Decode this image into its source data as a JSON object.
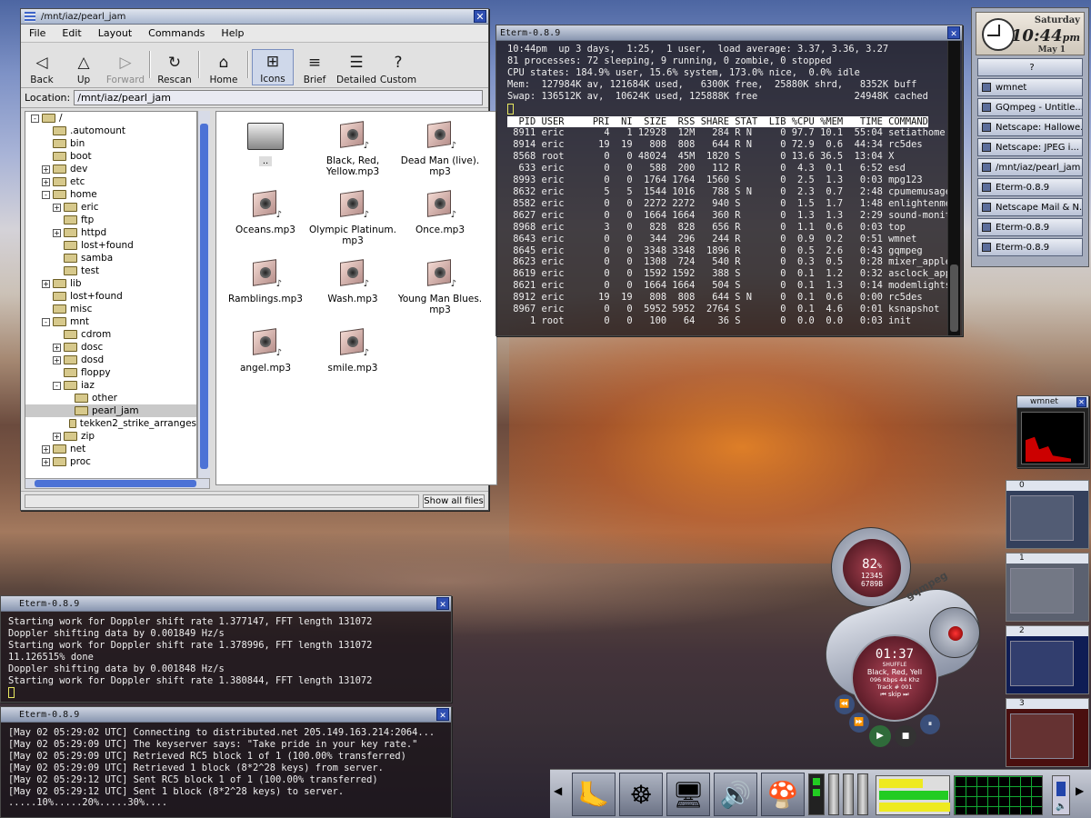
{
  "file_manager": {
    "title": "/mnt/iaz/pearl_jam",
    "menus": [
      "File",
      "Edit",
      "Layout",
      "Commands",
      "Help"
    ],
    "toolbar": [
      {
        "label": "Back",
        "icon": "◁",
        "state": "normal"
      },
      {
        "label": "Up",
        "icon": "△",
        "state": "normal"
      },
      {
        "label": "Forward",
        "icon": "▷",
        "state": "disabled"
      },
      {
        "label": "Rescan",
        "icon": "↻",
        "state": "normal"
      },
      {
        "label": "Home",
        "icon": "⌂",
        "state": "normal"
      },
      {
        "label": "Icons",
        "icon": "⊞",
        "state": "active"
      },
      {
        "label": "Brief",
        "icon": "≡",
        "state": "normal"
      },
      {
        "label": "Detailed",
        "icon": "☰",
        "state": "normal"
      },
      {
        "label": "Custom",
        "icon": "?",
        "state": "normal"
      }
    ],
    "location_label": "Location:",
    "location_value": "/mnt/iaz/pearl_jam",
    "tree": [
      {
        "label": "/",
        "level": 0,
        "pm": "-"
      },
      {
        "label": ".automount",
        "level": 1,
        "pm": ""
      },
      {
        "label": "bin",
        "level": 1,
        "pm": ""
      },
      {
        "label": "boot",
        "level": 1,
        "pm": ""
      },
      {
        "label": "dev",
        "level": 1,
        "pm": "+"
      },
      {
        "label": "etc",
        "level": 1,
        "pm": "+"
      },
      {
        "label": "home",
        "level": 1,
        "pm": "-"
      },
      {
        "label": "eric",
        "level": 2,
        "pm": "+"
      },
      {
        "label": "ftp",
        "level": 2,
        "pm": ""
      },
      {
        "label": "httpd",
        "level": 2,
        "pm": "+"
      },
      {
        "label": "lost+found",
        "level": 2,
        "pm": ""
      },
      {
        "label": "samba",
        "level": 2,
        "pm": ""
      },
      {
        "label": "test",
        "level": 2,
        "pm": ""
      },
      {
        "label": "lib",
        "level": 1,
        "pm": "+"
      },
      {
        "label": "lost+found",
        "level": 1,
        "pm": ""
      },
      {
        "label": "misc",
        "level": 1,
        "pm": ""
      },
      {
        "label": "mnt",
        "level": 1,
        "pm": "-"
      },
      {
        "label": "cdrom",
        "level": 2,
        "pm": ""
      },
      {
        "label": "dosc",
        "level": 2,
        "pm": "+"
      },
      {
        "label": "dosd",
        "level": 2,
        "pm": "+"
      },
      {
        "label": "floppy",
        "level": 2,
        "pm": ""
      },
      {
        "label": "iaz",
        "level": 2,
        "pm": "-"
      },
      {
        "label": "other",
        "level": 3,
        "pm": ""
      },
      {
        "label": "pearl_jam",
        "level": 3,
        "pm": "",
        "selected": true
      },
      {
        "label": "tekken2_strike_arranges",
        "level": 3,
        "pm": ""
      },
      {
        "label": "zip",
        "level": 2,
        "pm": "+"
      },
      {
        "label": "net",
        "level": 1,
        "pm": "+"
      },
      {
        "label": "proc",
        "level": 1,
        "pm": "+"
      }
    ],
    "files": [
      {
        "name": "..",
        "type": "folder"
      },
      {
        "name": "Black, Red, Yellow.mp3",
        "type": "mp3"
      },
      {
        "name": "Dead Man (live). mp3",
        "type": "mp3"
      },
      {
        "name": "Oceans.mp3",
        "type": "mp3"
      },
      {
        "name": "Olympic Platinum. mp3",
        "type": "mp3"
      },
      {
        "name": "Once.mp3",
        "type": "mp3"
      },
      {
        "name": "Ramblings.mp3",
        "type": "mp3"
      },
      {
        "name": "Wash.mp3",
        "type": "mp3"
      },
      {
        "name": "Young Man Blues. mp3",
        "type": "mp3"
      },
      {
        "name": "angel.mp3",
        "type": "mp3"
      },
      {
        "name": "smile.mp3",
        "type": "mp3"
      }
    ],
    "show_all_files": "Show all files"
  },
  "top_term": {
    "title": "Eterm-0.8.9",
    "header": [
      "10:44pm  up 3 days,  1:25,  1 user,  load average: 3.37, 3.36, 3.27",
      "81 processes: 72 sleeping, 9 running, 0 zombie, 0 stopped",
      "CPU states: 184.9% user, 15.6% system, 173.0% nice,  0.0% idle",
      "Mem:  127984K av, 121684K used,   6300K free,  25880K shrd,   8352K buff",
      "Swap: 136512K av,  10624K used, 125888K free                 24948K cached"
    ],
    "columns": "  PID USER     PRI  NI  SIZE  RSS SHARE STAT  LIB %CPU %MEM   TIME COMMAND",
    "rows": [
      " 8911 eric       4   1 12928  12M   284 R N     0 97.7 10.1  55:04 setiathome",
      " 8914 eric      19  19   808  808   644 R N     0 72.9  0.6  44:34 rc5des",
      " 8568 root       0   0 48024  45M  1820 S       0 13.6 36.5  13:04 X",
      "  633 eric       0   0   588  200   112 R       0  4.3  0.1   6:52 esd",
      " 8993 eric       0   0  1764 1764  1560 S       0  2.5  1.3   0:03 mpg123",
      " 8632 eric       5   5  1544 1016   788 S N     0  2.3  0.7   2:48 cpumemusage_",
      " 8582 eric       0   0  2272 2272   940 S       0  1.5  1.7   1:48 enlightenmen",
      " 8627 eric       0   0  1664 1664   360 R       0  1.3  1.3   2:29 sound-monito",
      " 8968 eric       3   0   828  828   656 R       0  1.1  0.6   0:03 top",
      " 8643 eric       0   0   344  296   244 R       0  0.9  0.2   0:51 wmnet",
      " 8645 eric       0   0  3348 3348  1896 R       0  0.5  2.6   0:43 gqmpeg",
      " 8623 eric       0   0  1308  724   540 R       0  0.3  0.5   0:28 mixer_applet",
      " 8619 eric       0   0  1592 1592   388 S       0  0.1  1.2   0:32 asclock_appl",
      " 8621 eric       0   0  1664 1664   504 S       0  0.1  1.3   0:14 modemlights_",
      " 8912 eric      19  19   808  808   644 S N     0  0.1  0.6   0:00 rc5des",
      " 8967 eric       0   0  5952 5952  2764 S       0  0.1  4.6   0:01 ksnapshot",
      "    1 root       0   0   100   64    36 S       0  0.0  0.0   0:03 init"
    ]
  },
  "seti_term": {
    "title": "Eterm-0.8.9",
    "lines": [
      "Starting work for Doppler shift rate 1.377147, FFT length 131072",
      "Doppler shifting data by 0.001849 Hz/s",
      "Starting work for Doppler shift rate 1.378996, FFT length 131072",
      "11.126515% done",
      "Doppler shifting data by 0.001848 Hz/s",
      "Starting work for Doppler shift rate 1.380844, FFT length 131072"
    ]
  },
  "dnet_term": {
    "title": "Eterm-0.8.9",
    "lines": [
      "[May 02 05:29:02 UTC] Connecting to distributed.net 205.149.163.214:2064...",
      "[May 02 05:29:09 UTC] The keyserver says: \"Take pride in your key rate.\"",
      "[May 02 05:29:09 UTC] Retrieved RC5 block 1 of 1 (100.00% transferred)",
      "[May 02 05:29:09 UTC] Retrieved 1 block (8*2^28 keys) from server.",
      "[May 02 05:29:12 UTC] Sent RC5 block 1 of 1 (100.00% transferred)",
      "[May 02 05:29:12 UTC] Sent 1 block (8*2^28 keys) to server.",
      ".....10%.....20%.....30%...."
    ]
  },
  "clock": {
    "day": "Saturday",
    "time": "10:44",
    "ampm": "pm",
    "date": "May 1"
  },
  "dock": {
    "help": "?",
    "items": [
      "wmnet",
      "GQmpeg - Untitle...",
      "Netscape: Hallowe...",
      "Netscape: JPEG i...",
      "/mnt/iaz/pearl_jam",
      "Eterm-0.8.9",
      "Netscape Mail & N...",
      "Eterm-0.8.9",
      "Eterm-0.8.9"
    ]
  },
  "wmnet": {
    "title": "wmnet"
  },
  "pager": {
    "desks": [
      "0",
      "1",
      "2",
      "3"
    ]
  },
  "gqmpeg": {
    "volume": "82",
    "volume_unit": "%",
    "track_nums": "12345",
    "track_nums2": "6789B",
    "time": "01:37",
    "mode": "SHUFFLE",
    "song": "Black, Red, Yell",
    "bitrate": "096 Kbps 44 Khz",
    "track": "Track # 001",
    "skip": "⏮ skip ⏭",
    "logo": "gqmpeg"
  },
  "colors": {
    "accent": "#2f4fb2",
    "term_bg": "#1a1418",
    "title_grad_top": "#dfe4ee"
  }
}
